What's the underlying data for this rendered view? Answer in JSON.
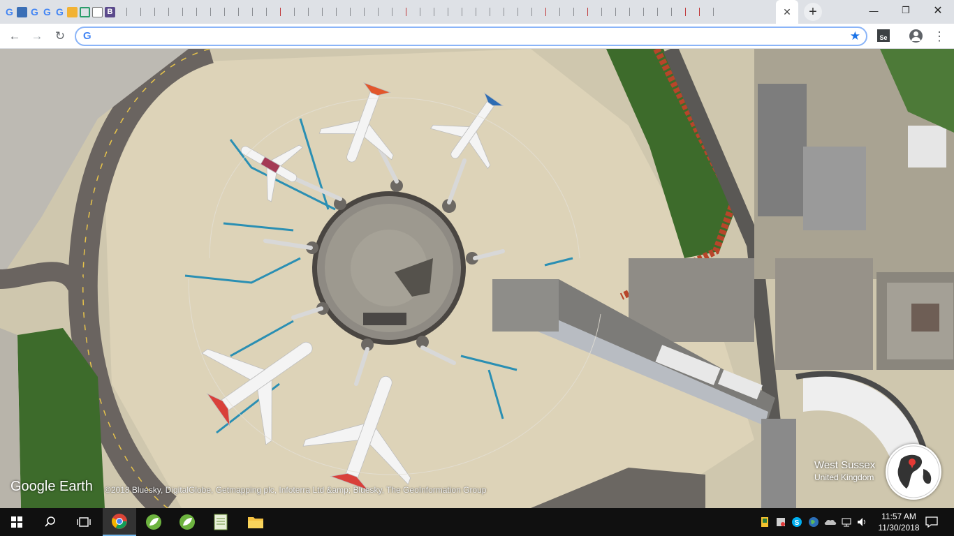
{
  "browser": {
    "tabs": [
      {
        "favicon": "google-icon",
        "label": "G"
      },
      {
        "favicon": "bookmark-app-icon",
        "label": ""
      },
      {
        "favicon": "google-icon",
        "label": "G"
      },
      {
        "favicon": "google-icon",
        "label": "G"
      },
      {
        "favicon": "google-icon",
        "label": "G"
      },
      {
        "favicon": "yellow-app-icon",
        "label": ""
      },
      {
        "favicon": "green-app-icon",
        "label": ""
      },
      {
        "favicon": "document-icon",
        "label": ""
      },
      {
        "favicon": "b-app-icon",
        "label": "B"
      }
    ],
    "active_tab_close": "✕",
    "new_tab": "+",
    "window": {
      "minimize": "—",
      "restore": "❐",
      "close": "✕"
    },
    "nav": {
      "back": "←",
      "forward": "→",
      "reload": "↻"
    },
    "omnibox": {
      "favicon": "G",
      "value": "",
      "placeholder": ""
    },
    "bookmark_star": "★",
    "extension_label": "Se",
    "menu": "⋮"
  },
  "earth": {
    "logo": "Google Earth",
    "attribution": "©2018 Bluesky, DigitalGlobe, Getmapping plc, Infoterra Ltd &amp; Bluesky, The GeoInformation Group",
    "location_region": "West Sussex",
    "location_country": "United Kingdom",
    "colors": {
      "apron": "#d8cfb6",
      "taxiway": "#5f5a55",
      "grass": "#3d6b2b",
      "accent_line": "#2a8fb3"
    }
  },
  "taskbar": {
    "items": [
      "windows-start-icon",
      "search-icon",
      "task-view-icon",
      "chrome-icon",
      "app-leaf-icon",
      "app-leaf-icon",
      "notepad-icon",
      "file-explorer-icon"
    ],
    "time": "11:57 AM",
    "date": "11/30/2018"
  }
}
